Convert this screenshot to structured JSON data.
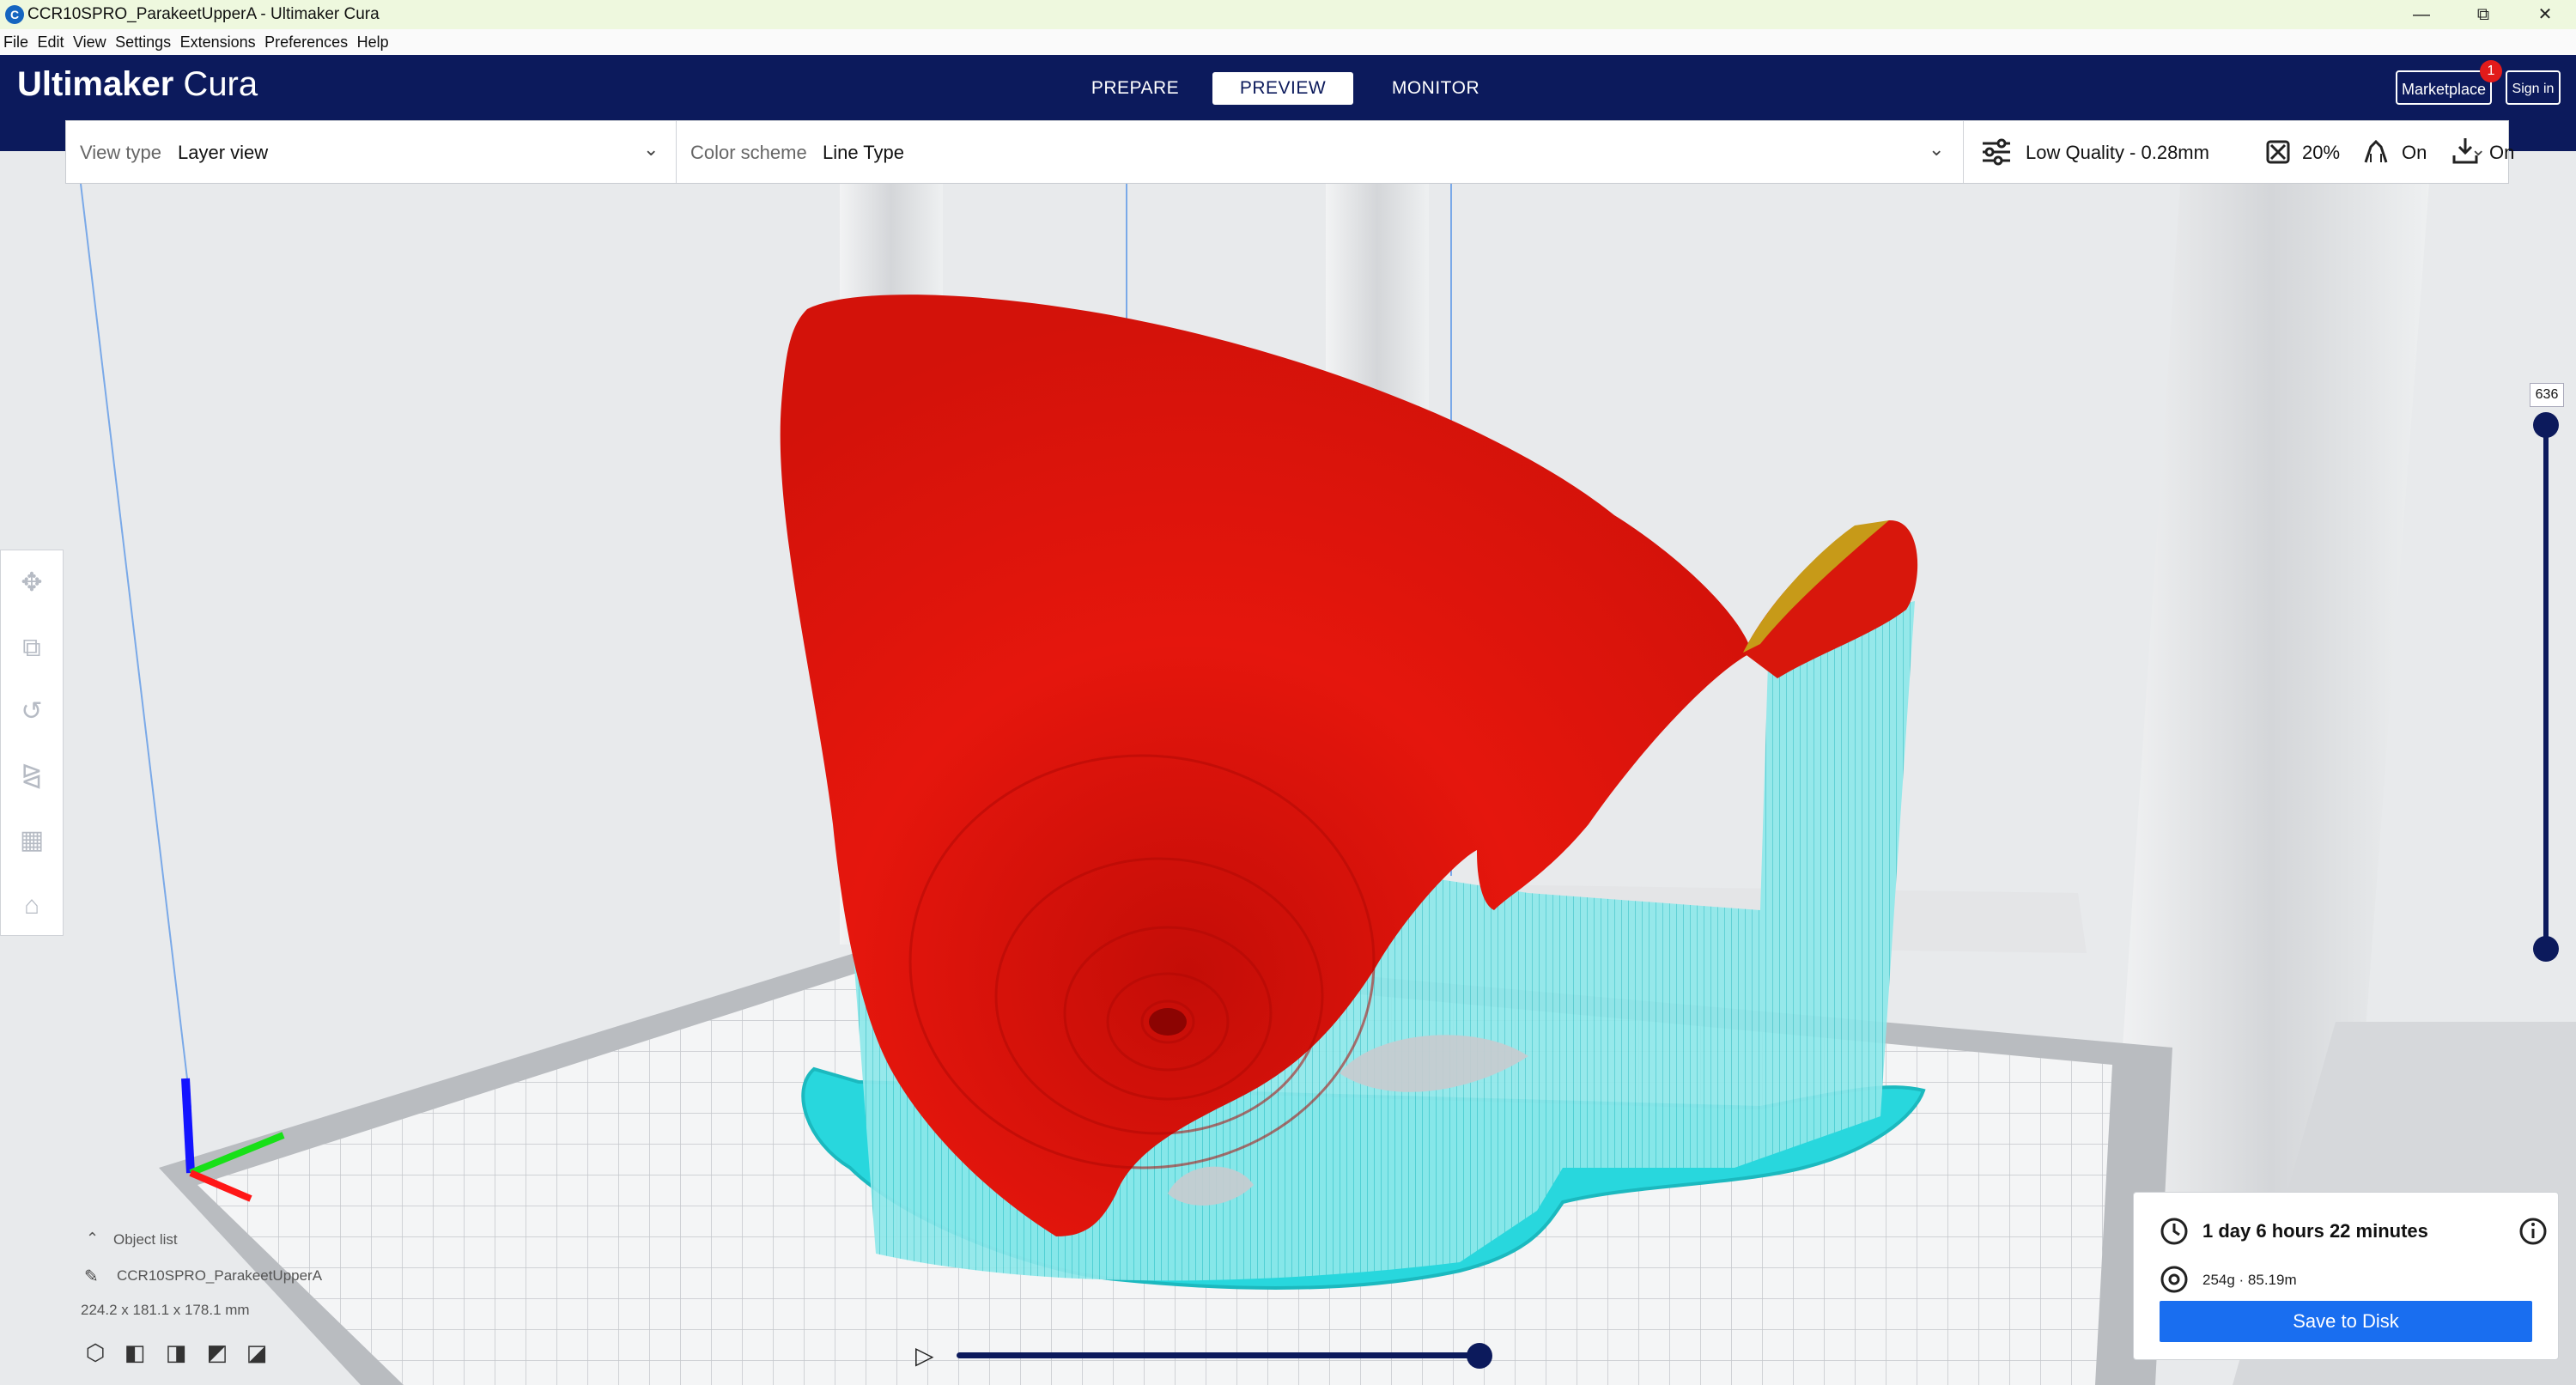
{
  "window": {
    "title": "CCR10SPRO_ParakeetUpperA - Ultimaker Cura",
    "app_icon": "C",
    "controls": {
      "minimize": "—",
      "restore": "⧉",
      "close": "✕"
    }
  },
  "menu": [
    "File",
    "Edit",
    "View",
    "Settings",
    "Extensions",
    "Preferences",
    "Help"
  ],
  "header": {
    "brand_bold": "Ultimaker",
    "brand_light": " Cura",
    "stages": [
      "PREPARE",
      "PREVIEW",
      "MONITOR"
    ],
    "active_stage": "PREVIEW",
    "marketplace_label": "Marketplace",
    "marketplace_badge": "1",
    "signin_label": "Sign in"
  },
  "toolbar": {
    "view_type_label": "View type",
    "view_type_value": "Layer view",
    "color_scheme_label": "Color scheme",
    "color_scheme_value": "Line Type",
    "profile": "Low Quality - 0.28mm",
    "infill": "20%",
    "support": "On",
    "adhesion": "On"
  },
  "left_tools": [
    "move-icon",
    "scale-icon",
    "rotate-icon",
    "mirror-icon",
    "per-model-settings-icon",
    "support-blocker-icon"
  ],
  "layer_slider": {
    "current_layer": "636"
  },
  "object_list": {
    "header": "Object list",
    "object_name": "CCR10SPRO_ParakeetUpperA",
    "dimensions": "224.2 x 181.1 x 178.1 mm"
  },
  "view_cubes": [
    "3d-view-icon",
    "front-view-icon",
    "top-view-icon",
    "left-view-icon",
    "right-view-icon"
  ],
  "print_info": {
    "time": "1 day 6 hours 22 minutes",
    "material": "254g · 85.19m",
    "save_label": "Save to Disk"
  },
  "colors": {
    "header_bg": "#0c1a5c",
    "model_wall": "#e4140c",
    "support": "#5fe4e6",
    "adhesion": "#2ed8de",
    "button_blue": "#196ef0"
  }
}
